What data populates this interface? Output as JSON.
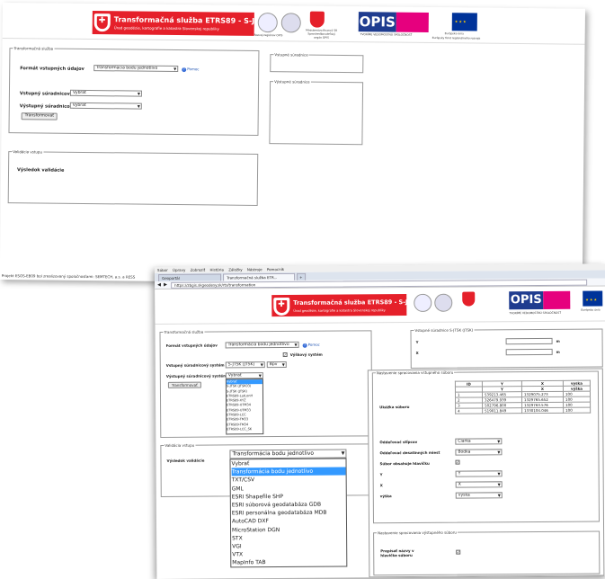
{
  "app": {
    "banner_title": "Transformačná služba ETRS89 - S-JTSK",
    "banner_subtitle": "Úrad geodézie, kartografie a katastra Slovenskej republiky",
    "ops_logo": "OPIS",
    "logo_captions": {
      "region": "Rozvoj regiónov OPIS",
      "ministry": "Ministerstvo financií SR Sprostredkovateľský orgán OPIS",
      "motto": "TVORÍME VEDOMOSTNÚ SPOLOČNOSŤ",
      "eu": "Európska únia",
      "eu_fund": "Európsky fond regionálneho rozvoja"
    }
  },
  "shot1": {
    "form_legend": "Transformačná služba",
    "input_format_label": "Formát vstupných údajov",
    "input_format_value": "Transformácia bodu jednotlivo",
    "help_label": "Pomoc",
    "input_system_label": "Vstupný súradnicový systém",
    "input_system_value": "Vybrať",
    "output_system_label": "Výstupný súradnicový systém",
    "output_system_value": "Vybrať",
    "transform_button": "Transformovať",
    "input_coords_legend": "Vstupné súradnice",
    "output_coords_legend": "Výstupné súradnice",
    "validation_legend": "Validácia vstupu",
    "validation_result": "Výsledok validácie",
    "status_text": "Projekt ESOS-EB09 bol zrealizovaný spoločnosťami: SEMTECH, a.s. a RESS"
  },
  "browser": {
    "menu": [
      "Súbor",
      "Úpravy",
      "Zobraziť",
      "História",
      "Záložky",
      "Nástroje",
      "Pomocník"
    ],
    "tabs": [
      "Geoportál",
      "Transformačná služba ETR..."
    ],
    "url": "https://zbgis.skgeodesy.sk/rts/transformation"
  },
  "shot2": {
    "form_legend": "Transformačná služba",
    "input_format_label": "Formát vstupných údajov",
    "input_format_value": "Transformácia bodu jednotlivo",
    "help_label": "Pomoc",
    "height_system_label": "Výškový systém",
    "input_system_label": "Vstupný súradnicový systém",
    "input_system_value": "S-JTSK (JTSK)",
    "unit_value": "Bpv",
    "output_system_label": "Výstupný súradnicový systém",
    "output_system_value": "Vybrať",
    "transform_button": "Transformovať",
    "output_system_options": [
      "Vybrať",
      "S-JTSK (JTSK03)",
      "S-JTSK (JTSK)",
      "ETRS89-LatLonH",
      "ETRS89-XYZ",
      "ETRS89-UTM34",
      "ETRS89-UTM33",
      "ETRS89-LCC",
      "ETRS89-TM33",
      "ETRS89-TM34",
      "ETRS89-LCC_SK"
    ],
    "input_coords_legend": "Vstupné súradnice S-JTSK (JTSK)",
    "coord_labels": [
      "Y",
      "X",
      "H"
    ],
    "coord_units": [
      "m",
      "m",
      ""
    ],
    "validation_legend": "Validácia vstupu",
    "validation_result": "Výsledok validácie",
    "format_dropdown_value": "Transformácia bodu jednotlivo",
    "format_options": [
      "Vybrať",
      "Transformácia bodu jednotlivo",
      "TXT/CSV",
      "GML",
      "ESRI Shapefile SHP",
      "ESRI súborová geodatabáza GDB",
      "ESRI personálna geodatabáza MDB",
      "AutoCAD DXF",
      "MicroStation DGN",
      "STX",
      "VGI",
      "VTX",
      "MapInfo TAB"
    ]
  },
  "settings_panel": {
    "legend": "Nastavenie spracovania vstupného súboru",
    "sample_label": "Ukážka súboru",
    "table_headers": [
      "ID",
      "Y",
      "X",
      "vyska"
    ],
    "table_subheaders": [
      "",
      "Y",
      "X",
      "výška"
    ],
    "rows": [
      [
        "1",
        "539213.465",
        "1329075.273",
        "100"
      ],
      [
        "2",
        "326479.939",
        "1329765.652",
        "100"
      ],
      [
        "3",
        "502796.800",
        "1329763.576",
        "100"
      ],
      [
        "4",
        "519011.849",
        "1330104.046",
        "100"
      ]
    ],
    "column_separator_label": "Oddeľovač stĺpcov",
    "column_separator_value": "Čiarka",
    "decimal_separator_label": "Oddeľovač desatinných miest",
    "decimal_separator_value": "Bodka",
    "header_label": "Súbor obsahuje hlavičku",
    "y_label": "Y",
    "y_value": "Y",
    "x_label": "X",
    "x_value": "X",
    "height_label": "výška",
    "height_value": "vyska",
    "output_legend": "Nastavenie spracovania výstupného súboru",
    "overwrite_label": "Prepísať názvy v hlavičke súboru"
  }
}
